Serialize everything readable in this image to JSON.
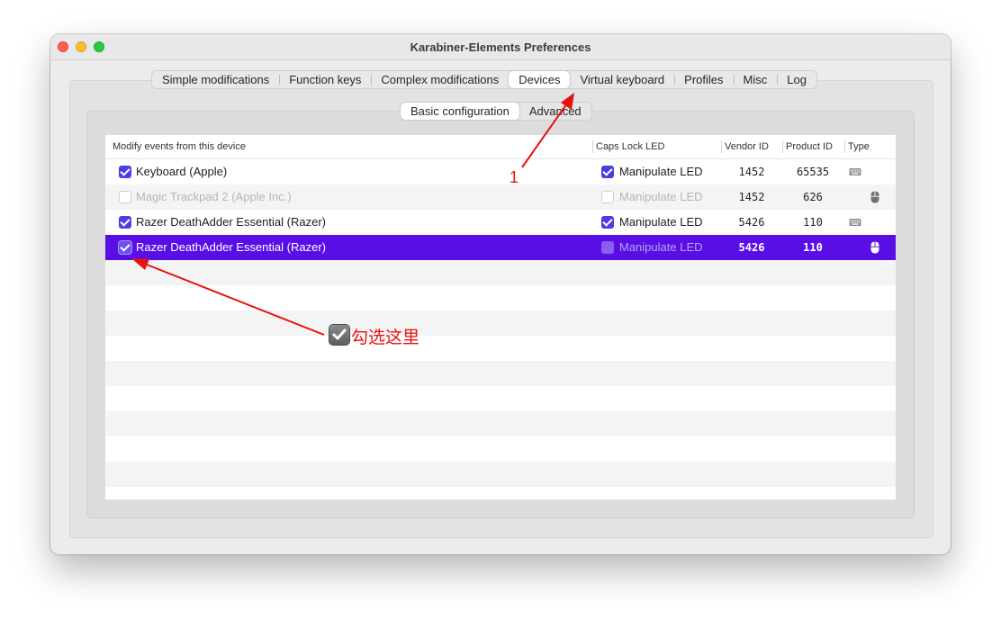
{
  "window": {
    "title": "Karabiner-Elements Preferences"
  },
  "tabs": [
    {
      "label": "Simple modifications",
      "selected": false
    },
    {
      "label": "Function keys",
      "selected": false
    },
    {
      "label": "Complex modifications",
      "selected": false
    },
    {
      "label": "Devices",
      "selected": true
    },
    {
      "label": "Virtual keyboard",
      "selected": false
    },
    {
      "label": "Profiles",
      "selected": false
    },
    {
      "label": "Misc",
      "selected": false
    },
    {
      "label": "Log",
      "selected": false
    }
  ],
  "subtabs": [
    {
      "label": "Basic configuration",
      "selected": true
    },
    {
      "label": "Advanced",
      "selected": false
    }
  ],
  "table": {
    "headers": {
      "modify": "Modify events from this device",
      "caps": "Caps Lock LED",
      "vendor": "Vendor ID",
      "product": "Product ID",
      "type": "Type"
    },
    "rows": [
      {
        "name": "Keyboard (Apple)",
        "modify": true,
        "enabled": true,
        "led_label": "Manipulate LED",
        "led": true,
        "vendor": "1452",
        "product": "65535",
        "type": "keyboard-icon"
      },
      {
        "name": "Magic Trackpad 2 (Apple Inc.)",
        "modify": false,
        "enabled": false,
        "led_label": "Manipulate LED",
        "led": false,
        "vendor": "1452",
        "product": "626",
        "type": "mouse-icon"
      },
      {
        "name": "Razer DeathAdder Essential (Razer)",
        "modify": true,
        "enabled": true,
        "led_label": "Manipulate LED",
        "led": true,
        "vendor": "5426",
        "product": "110",
        "type": "keyboard-icon"
      },
      {
        "name": "Razer DeathAdder Essential (Razer)",
        "modify": true,
        "enabled": true,
        "led_label": "Manipulate LED",
        "led": false,
        "vendor": "5426",
        "product": "110",
        "type": "mouse-icon",
        "selected": true
      }
    ]
  },
  "annotations": {
    "label_1": "1",
    "check_here": "勾选这里",
    "arrow_color": "#e8110c"
  },
  "colors": {
    "selection": "#5a0ee6",
    "checkbox": "#4c3de0"
  }
}
